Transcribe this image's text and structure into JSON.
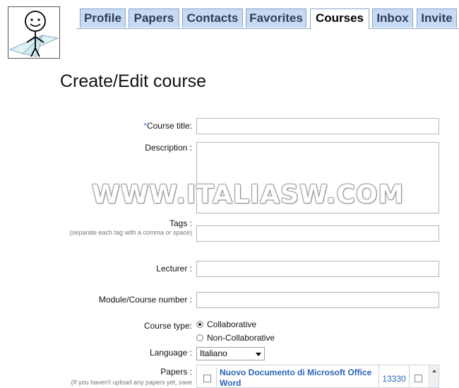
{
  "tabs": [
    {
      "label": "Profile"
    },
    {
      "label": "Papers"
    },
    {
      "label": "Contacts"
    },
    {
      "label": "Favorites"
    },
    {
      "label": "Courses",
      "active": true
    },
    {
      "label": "Inbox"
    },
    {
      "label": "Invite"
    }
  ],
  "page_title": "Create/Edit course",
  "form": {
    "required_mark": "*",
    "course_title_label": "Course title:",
    "description_label": "Description :",
    "tags_label": "Tags :",
    "tags_hint": "(separate each tag with a comma or space)",
    "lecturer_label": "Lecturer :",
    "module_label": "Module/Course number :",
    "course_type_label": "Course type:",
    "course_type_options": [
      "Collaborative",
      "Non-Collaborative"
    ],
    "course_type_selected": "Collaborative",
    "language_label": "Language :",
    "language_value": "Italiano",
    "papers_label": "Papers :",
    "papers_hint": "(If you haven't upload any papers yet, save",
    "papers": [
      {
        "name": "Nuovo Documento di Microsoft Office Word",
        "number": "13330"
      }
    ]
  },
  "watermark": "WWW.ITALIASW.COM",
  "colors": {
    "tab_bg": "#c6daf4",
    "link": "#2a64b8",
    "required": "#3a78c8"
  }
}
